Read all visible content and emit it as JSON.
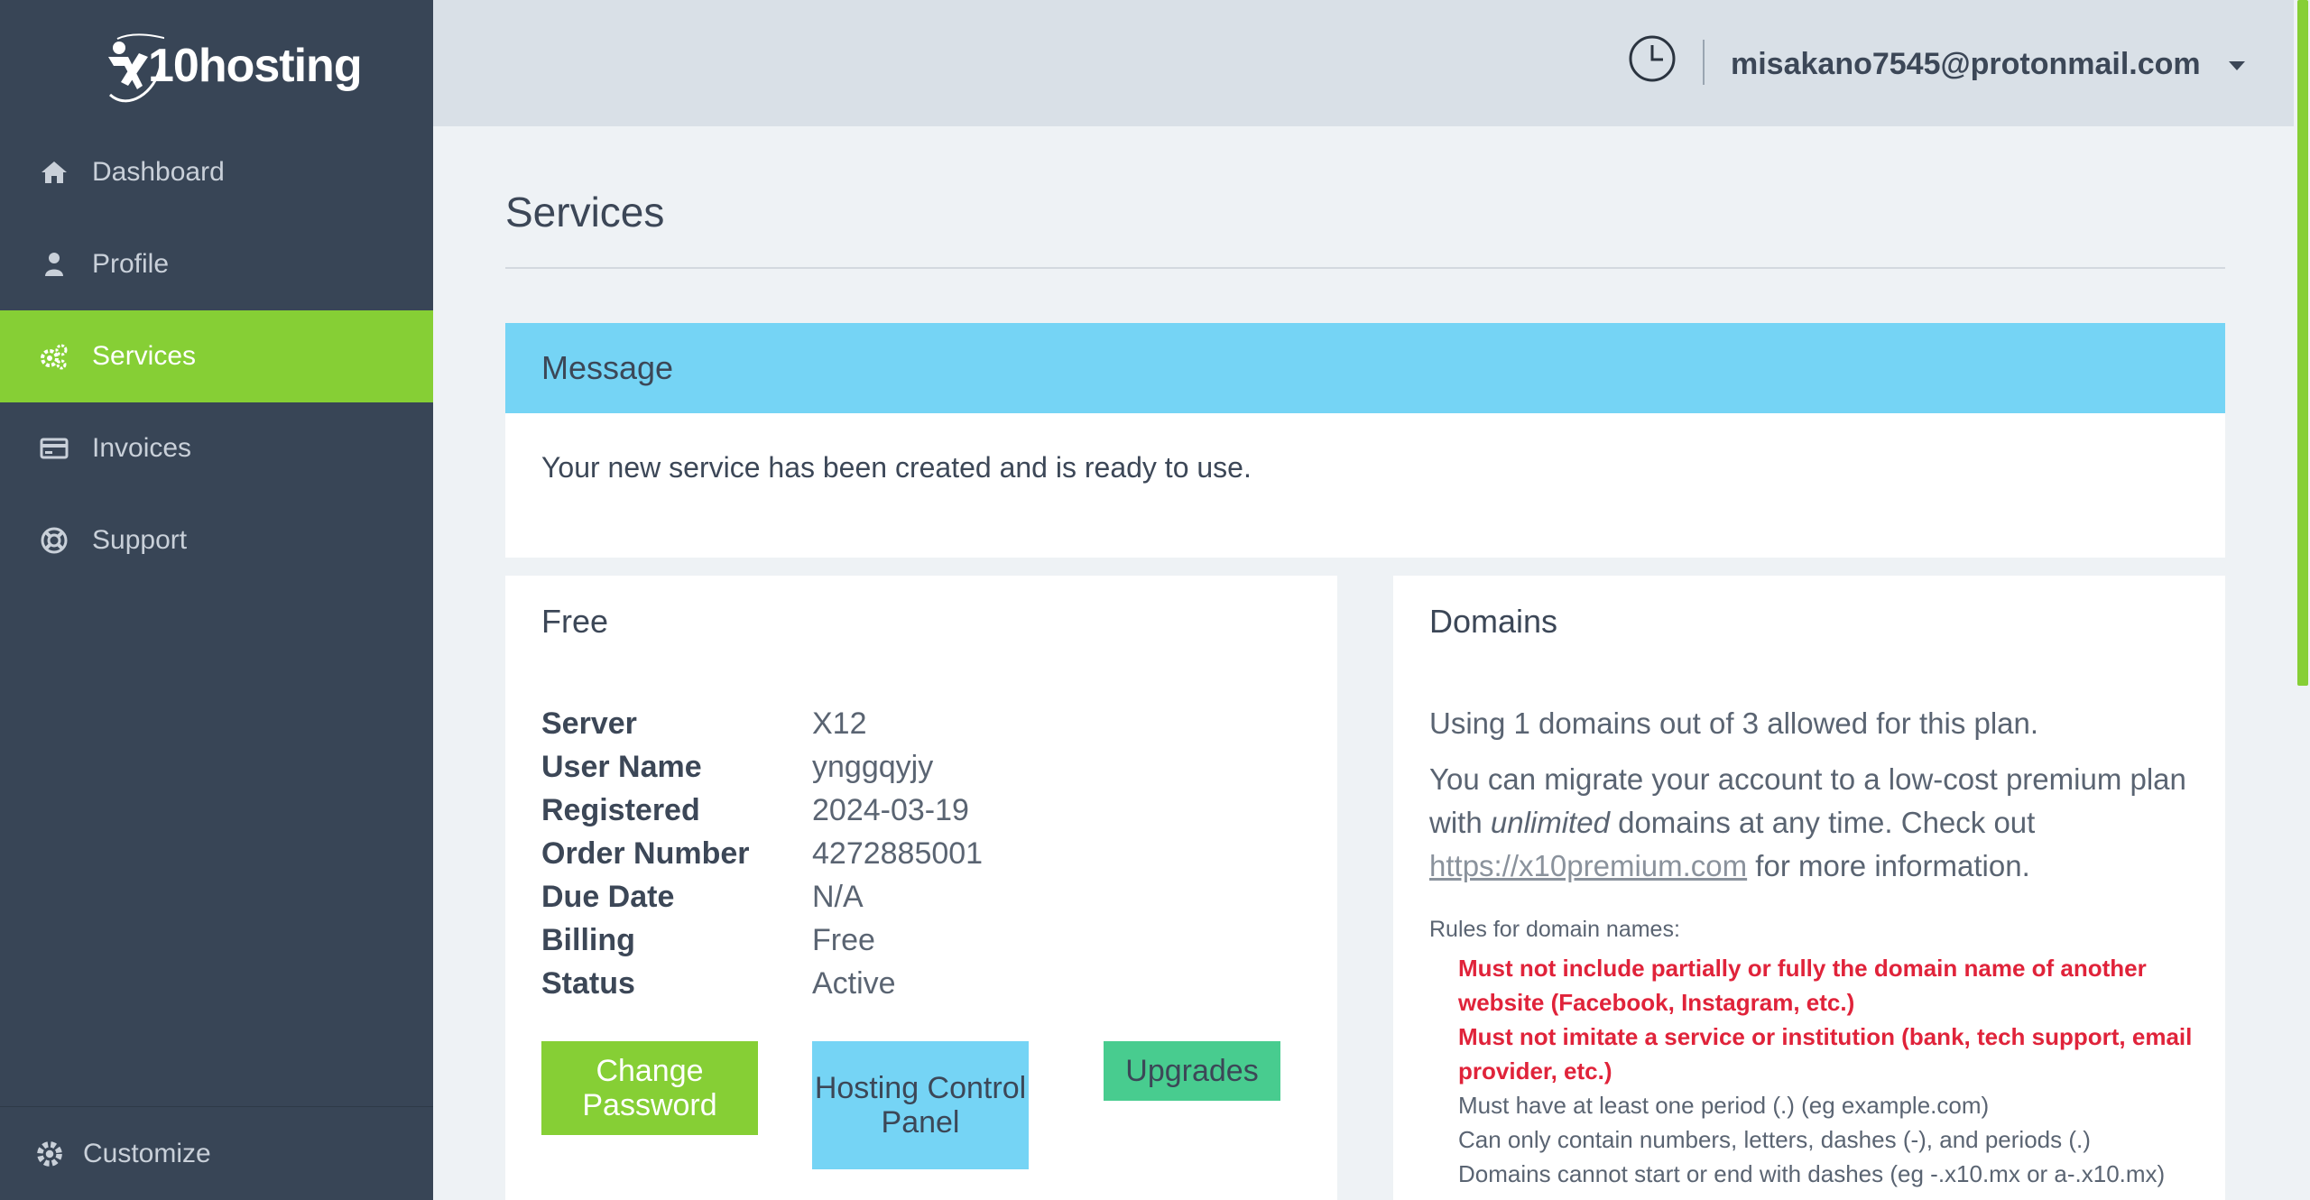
{
  "sidebar": {
    "logo_text": "10hosting",
    "items": [
      {
        "label": "Dashboard",
        "icon": "home-icon"
      },
      {
        "label": "Profile",
        "icon": "user-icon"
      },
      {
        "label": "Services",
        "icon": "gears-icon",
        "active": true
      },
      {
        "label": "Invoices",
        "icon": "credit-card-icon"
      },
      {
        "label": "Support",
        "icon": "lifebuoy-icon"
      }
    ],
    "customize_label": "Customize"
  },
  "topbar": {
    "user_email": "misakano7545@protonmail.com",
    "clock_icon": "clock-icon",
    "caret_icon": "caret-down-icon"
  },
  "main": {
    "page_title": "Services",
    "message": {
      "title": "Message",
      "body": "Your new service has been created and is ready to use."
    },
    "plan_card": {
      "title": "Free",
      "rows": [
        {
          "label": "Server",
          "value": "X12"
        },
        {
          "label": "User Name",
          "value": "ynggqyjy"
        },
        {
          "label": "Registered",
          "value": "2024-03-19"
        },
        {
          "label": "Order Number",
          "value": "4272885001"
        },
        {
          "label": "Due Date",
          "value": "N/A"
        },
        {
          "label": "Billing",
          "value": "Free"
        },
        {
          "label": "Status",
          "value": "Active"
        }
      ],
      "buttons": {
        "change_password": "Change Password",
        "hosting_control_panel": "Hosting Control Panel",
        "upgrades": "Upgrades"
      }
    },
    "domains_card": {
      "title": "Domains",
      "using_text": "Using 1 domains out of 3 allowed for this plan.",
      "migrate_pre": "You can migrate your account to a low-cost premium plan with ",
      "migrate_italic": "unlimited",
      "migrate_mid": " domains at any time. Check out ",
      "migrate_link": "https://x10premium.com",
      "migrate_post": " for more information.",
      "rules_title": "Rules for domain names:",
      "rules": [
        {
          "text": "Must not include partially or fully the domain name of another website (Facebook, Instagram, etc.)",
          "warn": true
        },
        {
          "text": "Must not imitate a service or institution (bank, tech support, email provider, etc.)",
          "warn": true
        },
        {
          "text": "Must have at least one period (.) (eg example.com)",
          "warn": false
        },
        {
          "text": "Can only contain numbers, letters, dashes (-), and periods (.)",
          "warn": false
        },
        {
          "text": "Domains cannot start or end with dashes (eg -.x10.mx or a-.x10.mx)",
          "warn": false
        }
      ]
    }
  },
  "colors": {
    "sidebar_bg": "#384556",
    "accent_green": "#86cf35",
    "message_blue": "#75d4f5",
    "upgrade_green": "#48cc8f",
    "warn_red": "#e0233a"
  }
}
